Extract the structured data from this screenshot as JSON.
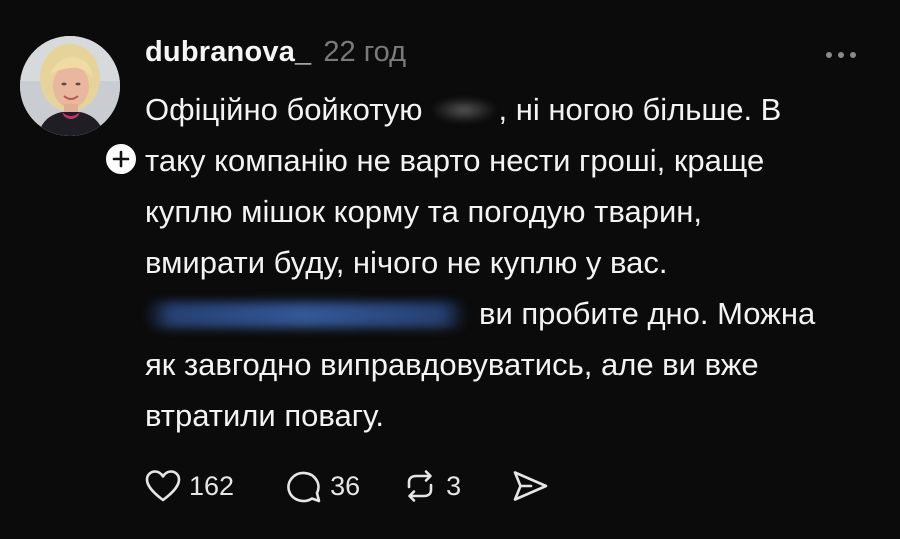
{
  "post": {
    "username": "dubranova_",
    "timestamp": "22 год",
    "lines": {
      "l1_a": "Офіційно бойкотую",
      "l1_b": ", ні ногою більше. В",
      "l2": "таку компанію не варто нести гроші, краще",
      "l3": "куплю мішок корму та погодую тварин,",
      "l4": "вмирати буду, нічого не куплю у вас.",
      "l5_b": "ви пробите дно. Можна",
      "l6": "як завгодно виправдовуватись, але ви вже",
      "l7": "втратили повагу."
    },
    "actions": {
      "likes": "162",
      "comments": "36",
      "reposts": "3"
    }
  },
  "icons": {
    "more": "more-horizontal-icon",
    "follow": "plus-icon",
    "like": "heart-icon",
    "comment": "comment-bubble-icon",
    "repost": "repost-icon",
    "share": "send-icon"
  },
  "colors": {
    "background": "#0b0b0b",
    "text": "#f3f3f3",
    "muted": "#7a7a7a"
  }
}
